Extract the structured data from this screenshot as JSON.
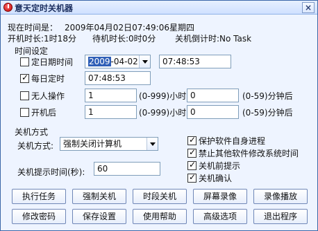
{
  "window": {
    "title": "意天定时关机器",
    "close_label": "×"
  },
  "status": {
    "current_time_label": "现在时间是：",
    "current_time_value": "2009年04月02日07:49:06星期四",
    "boot_duration": "开机时长:1时18分",
    "idle_duration": "待机时长:0时0分",
    "shutdown_countdown": "关机倒计时:No Task"
  },
  "time_settings": {
    "title": "时间设定",
    "scheduled_datetime": {
      "label": "定日期时间",
      "checked": false,
      "date_year_selected": "2009",
      "date_rest": "-04-02",
      "time": "07:48:53"
    },
    "daily": {
      "label": "每日定时",
      "checked": true,
      "time": "07:48:53"
    },
    "idle": {
      "label": "无人操作",
      "checked": false,
      "hours": "1",
      "hours_suffix": "(0-999)小时",
      "minutes": "0",
      "minutes_suffix": "(0-59)分钟后"
    },
    "after_boot": {
      "label": "开机后",
      "checked": false,
      "hours": "1",
      "hours_suffix": "(0-999)小时",
      "minutes": "0",
      "minutes_suffix": "(0-59)分钟后"
    }
  },
  "shutdown_mode": {
    "title": "关机方式",
    "mode_label": "关机方式:",
    "mode_value": "强制关闭计算机",
    "prompt_label": "关机提示时间(秒):",
    "prompt_value": "60",
    "options": [
      {
        "label": "保护软件自身进程",
        "checked": true
      },
      {
        "label": "禁止其他软件修改系统时间",
        "checked": true
      },
      {
        "label": "关机前提示",
        "checked": true
      },
      {
        "label": "关机确认",
        "checked": true
      }
    ]
  },
  "buttons": {
    "row1": [
      "执行任务",
      "强制关机",
      "时段关机",
      "屏幕录像",
      "录像播放"
    ],
    "row2": [
      "修改密码",
      "保存设置",
      "使用帮助",
      "高级选项",
      "退出程序"
    ]
  }
}
